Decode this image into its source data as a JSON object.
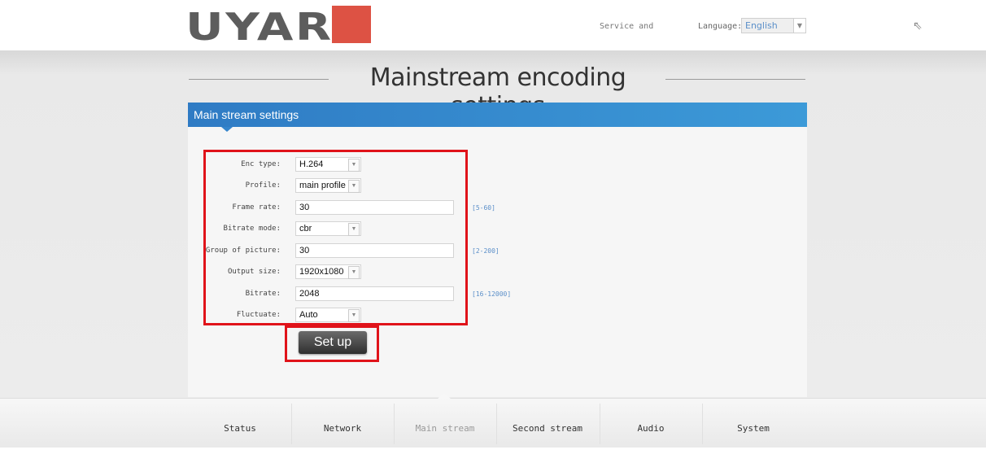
{
  "header": {
    "logo_text": "UYAR",
    "service_label": "Service and",
    "language_label": "Language:",
    "language_value": "English",
    "brand_red": "#dd5244"
  },
  "page_title": "Mainstream encoding settings",
  "panel": {
    "title": "Main stream settings",
    "header_color": "#2f7bc4"
  },
  "form": {
    "enc_type": {
      "label": "Enc type:",
      "value": "H.264"
    },
    "profile": {
      "label": "Profile:",
      "value": "main profile"
    },
    "frame_rate": {
      "label": "Frame rate:",
      "value": "30",
      "range": "[5-60]"
    },
    "bitrate_mode": {
      "label": "Bitrate mode:",
      "value": "cbr"
    },
    "gop": {
      "label": "Group of picture:",
      "value": "30",
      "range": "[2-200]"
    },
    "output_size": {
      "label": "Output size:",
      "value": "1920x1080"
    },
    "bitrate": {
      "label": "Bitrate:",
      "value": "2048",
      "range": "[16-12000]"
    },
    "fluctuate": {
      "label": "Fluctuate:",
      "value": "Auto"
    },
    "setup_button": "Set up"
  },
  "icons": {
    "dropdown": "chevron-down-icon",
    "cursor": "mouse-pointer-icon"
  },
  "nav": {
    "items": [
      "Status",
      "Network",
      "Main stream",
      "Second stream",
      "Audio",
      "System"
    ],
    "active": "Main stream"
  },
  "highlight_color": "#e0131a"
}
